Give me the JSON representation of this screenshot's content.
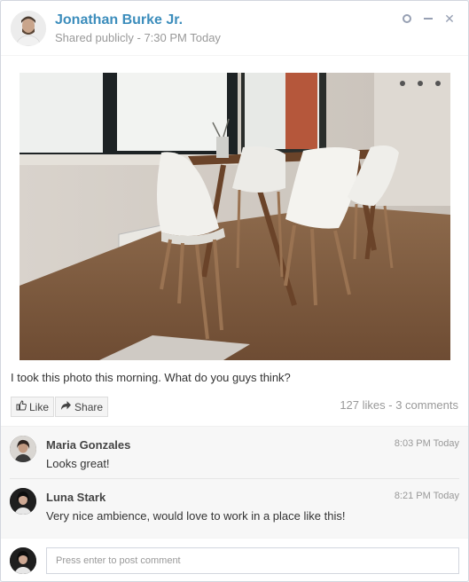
{
  "post": {
    "author": "Jonathan Burke Jr.",
    "description": "Shared publicly - 7:30 PM Today",
    "text": "I took this photo this morning. What do you guys think?",
    "like_label": "Like",
    "share_label": "Share",
    "stats": "127 likes - 3 comments"
  },
  "comments": [
    {
      "name": "Maria Gonzales",
      "time": "8:03 PM Today",
      "text": "Looks great!"
    },
    {
      "name": "Luna Stark",
      "time": "8:21 PM Today",
      "text": "Very nice ambience, would love to work in a place like this!"
    }
  ],
  "footer": {
    "placeholder": "Press enter to post comment"
  },
  "icons": {
    "like": "thumbs-up-icon",
    "share": "share-icon",
    "collapse": "circle-icon",
    "minimize": "minus-icon",
    "close": "close-icon"
  },
  "colors": {
    "accent": "#3c8dbc",
    "muted": "#999999",
    "comments_bg": "#f7f7f7"
  }
}
